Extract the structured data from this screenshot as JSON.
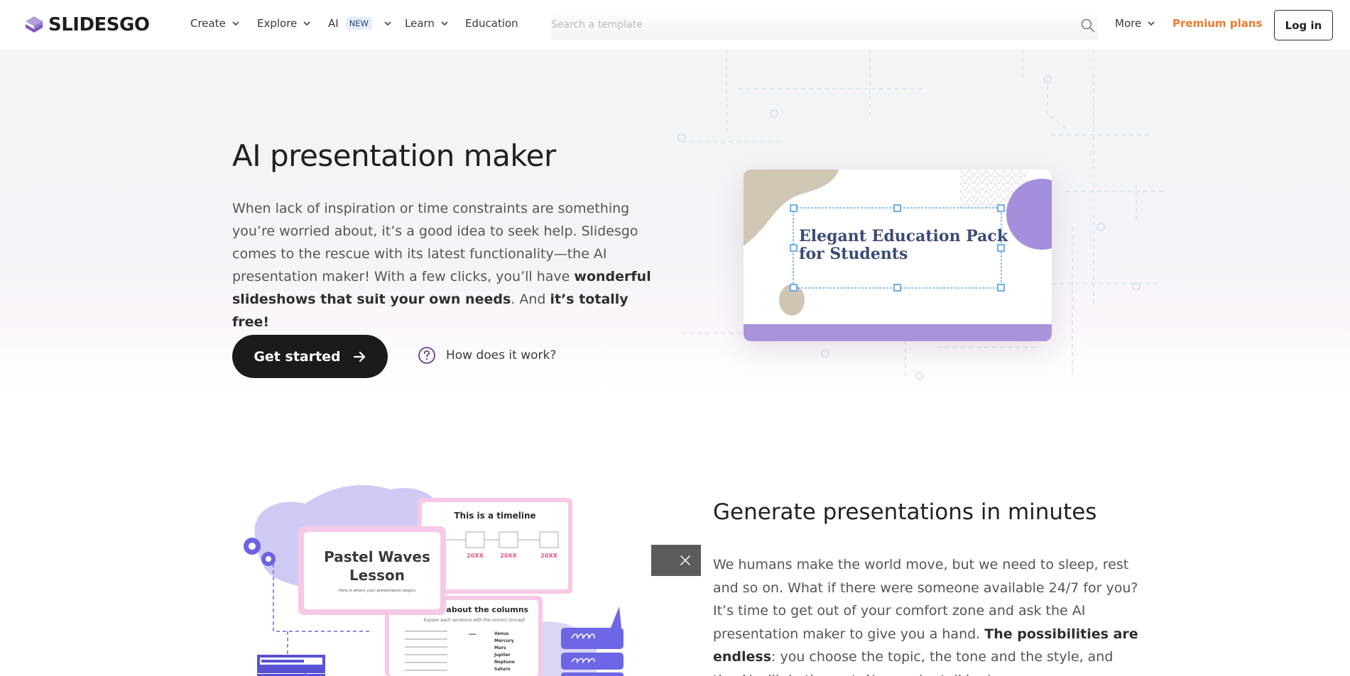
{
  "header": {
    "logo_text": "SLIDESGO",
    "nav": [
      {
        "label": "Create",
        "has_dropdown": true
      },
      {
        "label": "Explore",
        "has_dropdown": true
      },
      {
        "label": "AI",
        "badge": "NEW",
        "has_dropdown": true
      },
      {
        "label": "Learn",
        "has_dropdown": true
      },
      {
        "label": "Education",
        "has_dropdown": false
      }
    ],
    "search_placeholder": "Search a template",
    "more_label": "More",
    "premium_label": "Premium plans",
    "login_label": "Log in"
  },
  "hero": {
    "title": "AI presentation maker",
    "desc_part1": "When lack of inspiration or time constraints are something you’re worried about, it’s a good idea to seek help. Slidesgo comes to the rescue with its latest functionality—the AI presentation maker! With a few clicks, you’ll have ",
    "desc_bold1": "wonderful slideshows that suit your own needs",
    "desc_part2": ". And ",
    "desc_bold2": "it’s totally free!",
    "cta_label": "Get started",
    "how_label": "How does it work?",
    "slide_title": "Elegant Education Pack for Students"
  },
  "section2": {
    "title": "Generate presentations in minutes",
    "desc_part1": "We humans make the world move, but we need to sleep, rest and so on. What if there were someone available 24/7 for you? It’s time to get out of your comfort zone and ask the AI presentation maker to give you a hand. ",
    "desc_bold1": "The possibilities are endless",
    "desc_part2": ": you choose the topic, the tone and the style, and the AI will do the rest. Now we’re talking!",
    "illustration": {
      "card_main_title": "Pastel Waves Lesson",
      "card_main_sub": "Here is where your presentation begins",
      "card_timeline_title": "This is a timeline",
      "timeline_values": [
        "20XX",
        "20XX",
        "20XX"
      ],
      "card_columns_title": "What about the columns",
      "card_columns_sub": "Explain each sentence with the correct concept",
      "columns_list": [
        "Venus",
        "Mercury",
        "Mars",
        "Jupiter",
        "Neptune",
        "Saturn"
      ]
    }
  },
  "colors": {
    "premium": "#ef7a2f",
    "accent_purple": "#a890d8",
    "logo_purple": "#8e6cc5",
    "cta_bg": "#1b1b1b"
  }
}
